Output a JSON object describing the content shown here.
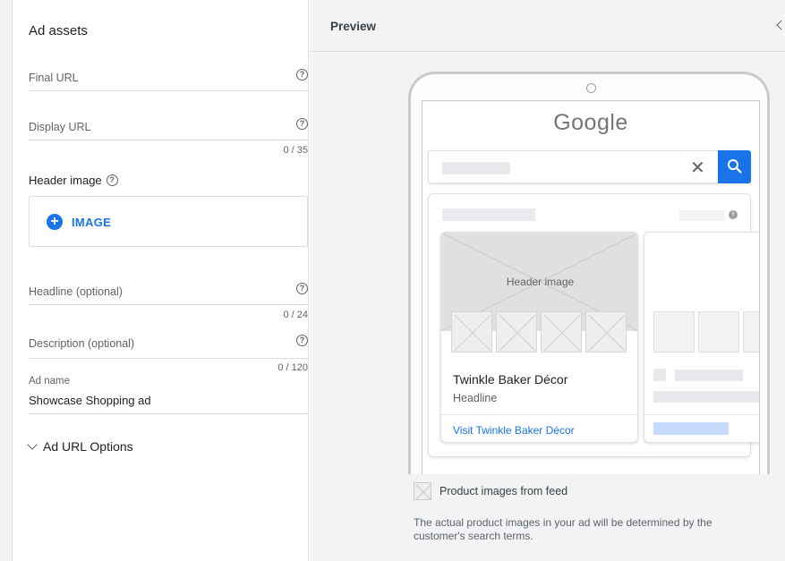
{
  "form": {
    "title": "Ad assets",
    "final_url": {
      "label": "Final URL",
      "help": "?"
    },
    "display_url": {
      "label": "Display URL",
      "help": "?",
      "counter": "0 / 35"
    },
    "header_image": {
      "label": "Header image",
      "help": "?",
      "button_label": "IMAGE",
      "plus": "+"
    },
    "headline": {
      "label": "Headline (optional)",
      "help": "?",
      "counter": "0 / 24"
    },
    "description": {
      "label": "Description (optional)",
      "help": "?",
      "counter": "0 / 120"
    },
    "ad_name": {
      "label": "Ad name",
      "value": "Showcase Shopping ad"
    },
    "url_options": "Ad URL Options"
  },
  "preview": {
    "title": "Preview",
    "google_logo": "Google",
    "clear": "✕",
    "info": "i",
    "card": {
      "header_image_label": "Header image",
      "title": "Twinkle Baker Décor",
      "subtitle": "Headline",
      "link": "Visit Twinkle Baker Décor"
    },
    "legend": "Product images from feed",
    "note": "The actual product images in your ad will be determined by the customer's search terms."
  },
  "colors": {
    "accent": "#1a73e8",
    "placeholder": "#e8eaed",
    "link_placeholder": "#c6dafc"
  },
  "icons": {
    "help": "question-circle-icon",
    "plus": "plus-circle-icon",
    "chevron": "chevron-down-icon",
    "collapse": "chevron-left-icon",
    "search": "search-icon",
    "clear": "close-icon",
    "info": "info-icon"
  }
}
